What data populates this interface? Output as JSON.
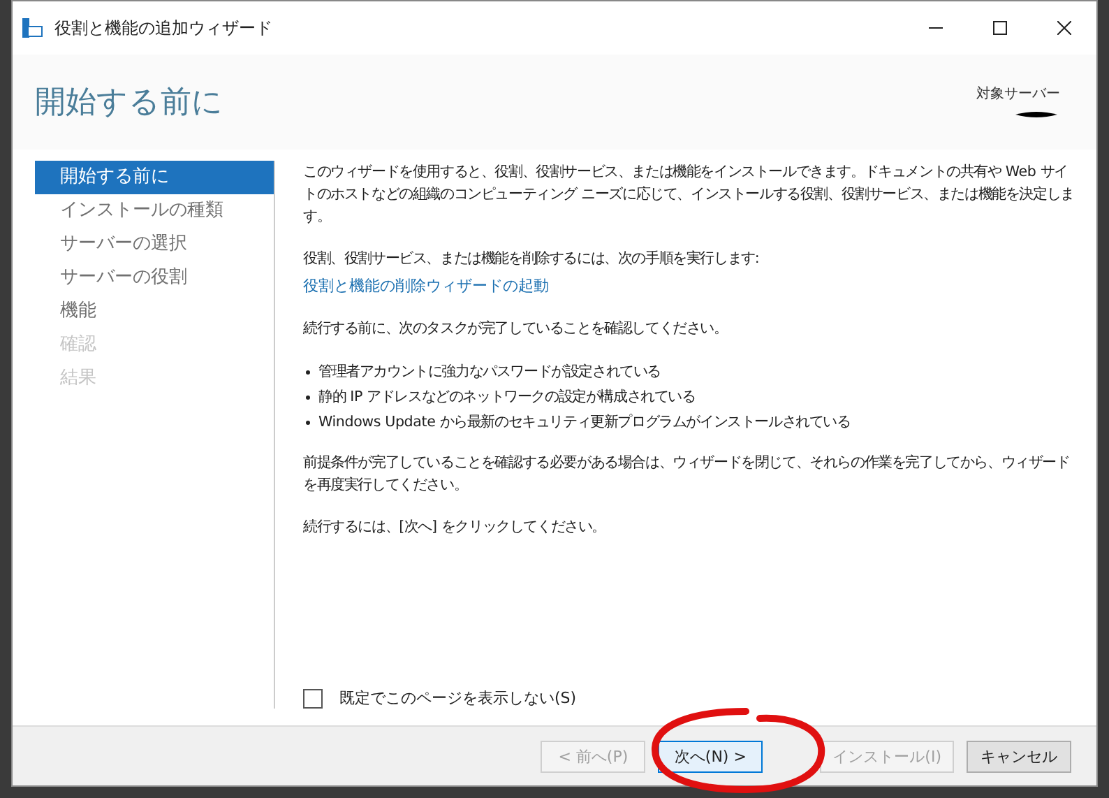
{
  "window": {
    "title": "役割と機能の追加ウィザード"
  },
  "header": {
    "title": "開始する前に",
    "target_label": "対象サーバー"
  },
  "steps": [
    {
      "label": "開始する前に",
      "selected": true,
      "disabled": false
    },
    {
      "label": "インストールの種類",
      "selected": false,
      "disabled": false
    },
    {
      "label": "サーバーの選択",
      "selected": false,
      "disabled": false
    },
    {
      "label": "サーバーの役割",
      "selected": false,
      "disabled": false
    },
    {
      "label": "機能",
      "selected": false,
      "disabled": false
    },
    {
      "label": "確認",
      "selected": false,
      "disabled": true
    },
    {
      "label": "結果",
      "selected": false,
      "disabled": true
    }
  ],
  "content": [
    {
      "kind": "paragraph",
      "text": "このウィザードを使用すると、役割、役割サービス、または機能をインストールできます。ドキュメントの共有や Web サイトのホストなどの組織のコンピューティング ニーズに応じて、インストールする役割、役割サービス、または機能を決定します。"
    },
    {
      "kind": "paragraph_link",
      "text": "役割、役割サービス、または機能を削除するには、次の手順を実行します:",
      "link": "役割と機能の削除ウィザードの起動"
    },
    {
      "kind": "paragraph",
      "text": "続行する前に、次のタスクが完了していることを確認してください。"
    },
    {
      "kind": "bullets",
      "items": [
        "管理者アカウントに強力なパスワードが設定されている",
        "静的 IP アドレスなどのネットワークの設定が構成されている",
        "Windows Update から最新のセキュリティ更新プログラムがインストールされている"
      ]
    },
    {
      "kind": "paragraph",
      "text": "前提条件が完了していることを確認する必要がある場合は、ウィザードを閉じて、それらの作業を完了してから、ウィザードを再度実行してください。"
    },
    {
      "kind": "paragraph",
      "text": "続行するには、[次へ] をクリックしてください。"
    }
  ],
  "skip_checkbox": {
    "label": "既定でこのページを表示しない(S)",
    "checked": false
  },
  "buttons": [
    {
      "label": "< 前へ(P)",
      "disabled": true,
      "focused": false
    },
    {
      "label": "次へ(N) >",
      "disabled": false,
      "focused": true
    },
    {
      "label": "インストール(I)",
      "disabled": true,
      "focused": false
    },
    {
      "label": "キャンセル",
      "disabled": false,
      "focused": false
    }
  ]
}
